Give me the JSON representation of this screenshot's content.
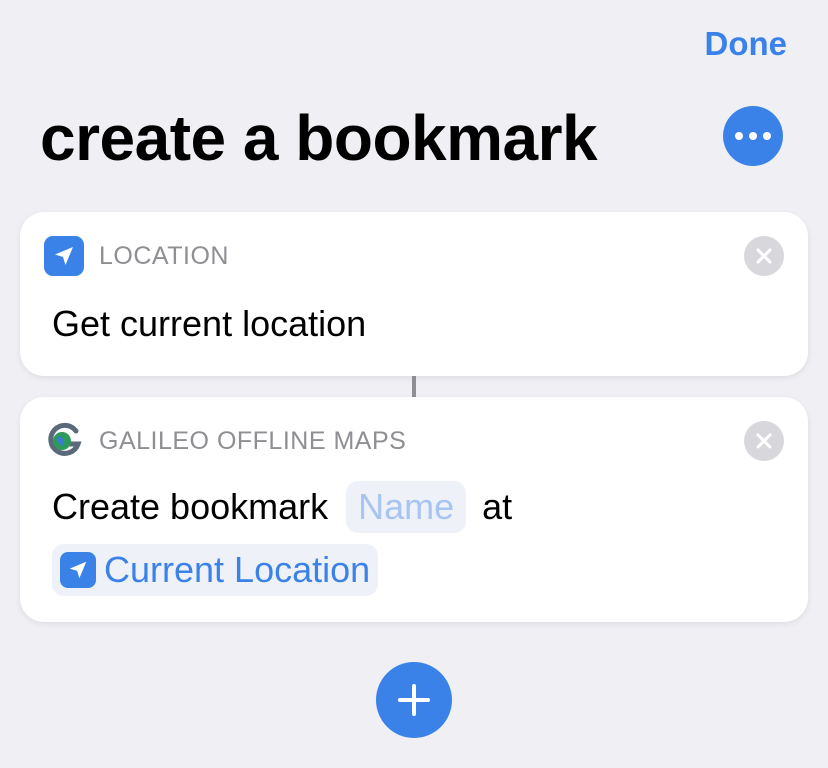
{
  "header": {
    "done_label": "Done",
    "title": "create a bookmark",
    "more_icon": "ellipsis-icon"
  },
  "actions": [
    {
      "category": "LOCATION",
      "icon": "location-arrow-icon",
      "text": "Get current location"
    },
    {
      "category": "GALILEO OFFLINE MAPS",
      "icon": "galileo-app-icon",
      "text_before": "Create bookmark",
      "name_placeholder": "Name",
      "text_middle": "at",
      "location_token": "Current Location"
    }
  ],
  "footer": {
    "add_icon": "plus-icon"
  },
  "colors": {
    "accent": "#3b82e8",
    "background": "#efeff4",
    "category_gray": "#8e8e93",
    "placeholder": "#a7c4f2"
  }
}
